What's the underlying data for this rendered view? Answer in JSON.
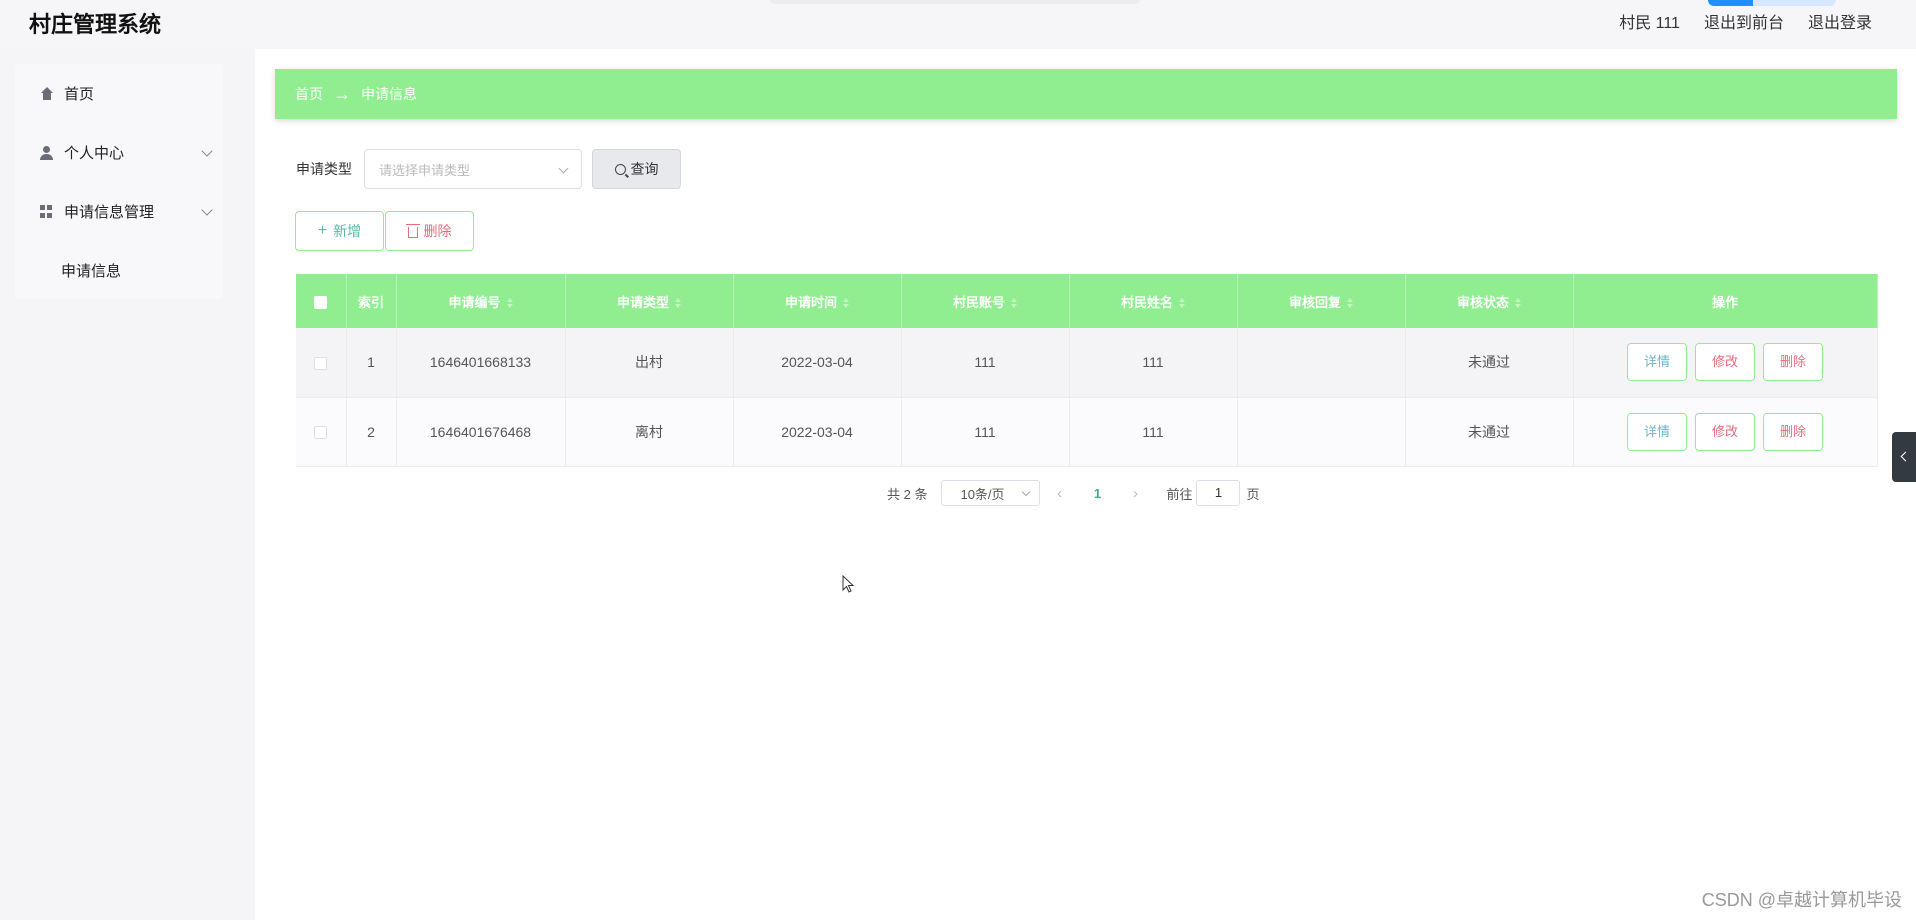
{
  "header": {
    "app_title": "村庄管理系统",
    "user_label": "村民 111",
    "front_link": "退出到前台",
    "logout_link": "退出登录"
  },
  "sidebar": {
    "items": [
      {
        "label": "首页",
        "icon": "home-icon"
      },
      {
        "label": "个人中心",
        "icon": "user-icon"
      },
      {
        "label": "申请信息管理",
        "icon": "grid-icon"
      }
    ],
    "subitem": "申请信息"
  },
  "breadcrumb": {
    "home": "首页",
    "separator": "→",
    "current": "申请信息"
  },
  "filter": {
    "label": "申请类型",
    "placeholder": "请选择申请类型",
    "query_button": "查询"
  },
  "actions": {
    "add": "新增",
    "delete": "删除"
  },
  "table": {
    "headers": [
      "索引",
      "申请编号",
      "申请类型",
      "申请时间",
      "村民账号",
      "村民姓名",
      "审核回复",
      "审核状态",
      "操作"
    ],
    "rows": [
      {
        "index": "1",
        "code": "1646401668133",
        "type": "出村",
        "time": "2022-03-04",
        "account": "111",
        "name": "111",
        "reply": "",
        "status": "未通过"
      },
      {
        "index": "2",
        "code": "1646401676468",
        "type": "离村",
        "time": "2022-03-04",
        "account": "111",
        "name": "111",
        "reply": "",
        "status": "未通过"
      }
    ],
    "row_buttons": {
      "detail": "详情",
      "edit": "修改",
      "delete": "删除"
    }
  },
  "pagination": {
    "total": "共 2 条",
    "page_size": "10条/页",
    "current_page": "1",
    "goto_label": "前往",
    "goto_value": "1",
    "page_suffix": "页"
  },
  "watermark": "CSDN @卓越计算机毕设",
  "colors": {
    "accent": "#90ee90",
    "danger": "#e56c7b",
    "info": "#6bb6c8"
  }
}
